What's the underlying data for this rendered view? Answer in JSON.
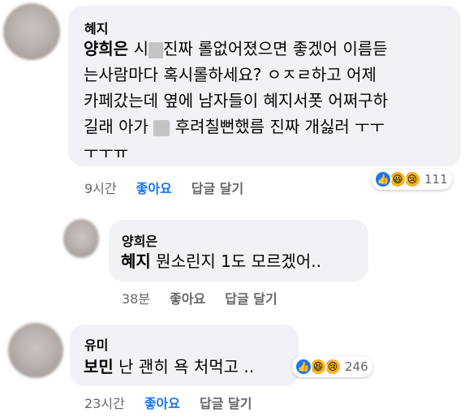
{
  "comments": [
    {
      "author": "혜지",
      "mention": "양희은",
      "line1_a": "시",
      "line1_b": "진짜 롤없어졌으면 좋겠어 이름듣",
      "line2": "는사람마다  혹시롤하세요? ㅇㅈㄹ하고 어제",
      "line3": "카페갔는데 옆에 남자들이 혜지서폿 어쩌구하",
      "line4_a": "길래 아가",
      "line4_b": "후려칠뻔했름 진짜 개싫러 ㅜㅜ",
      "line5": "ㅜㅜㅠ",
      "time": "9시간",
      "like": "좋아요",
      "reply": "답글 달기",
      "reaction_count": "111"
    },
    {
      "author": "양희은",
      "mention": "혜지",
      "text": "뭔소린지 1도 모르겠어..",
      "time": "38분",
      "like": "좋아요",
      "reply": "답글 달기"
    },
    {
      "author": "유미",
      "mention": "보민",
      "text": "난 괜히 욕 처먹고 ..",
      "time": "23시간",
      "like": "좋아요",
      "reply": "답글 달기",
      "reaction_count": "246"
    }
  ],
  "reaction_icons": [
    "like-icon",
    "haha-icon",
    "sad-icon"
  ],
  "colors": {
    "bubble": "#f0f2f5",
    "like_active": "#1877f2",
    "meta": "#65676b"
  }
}
